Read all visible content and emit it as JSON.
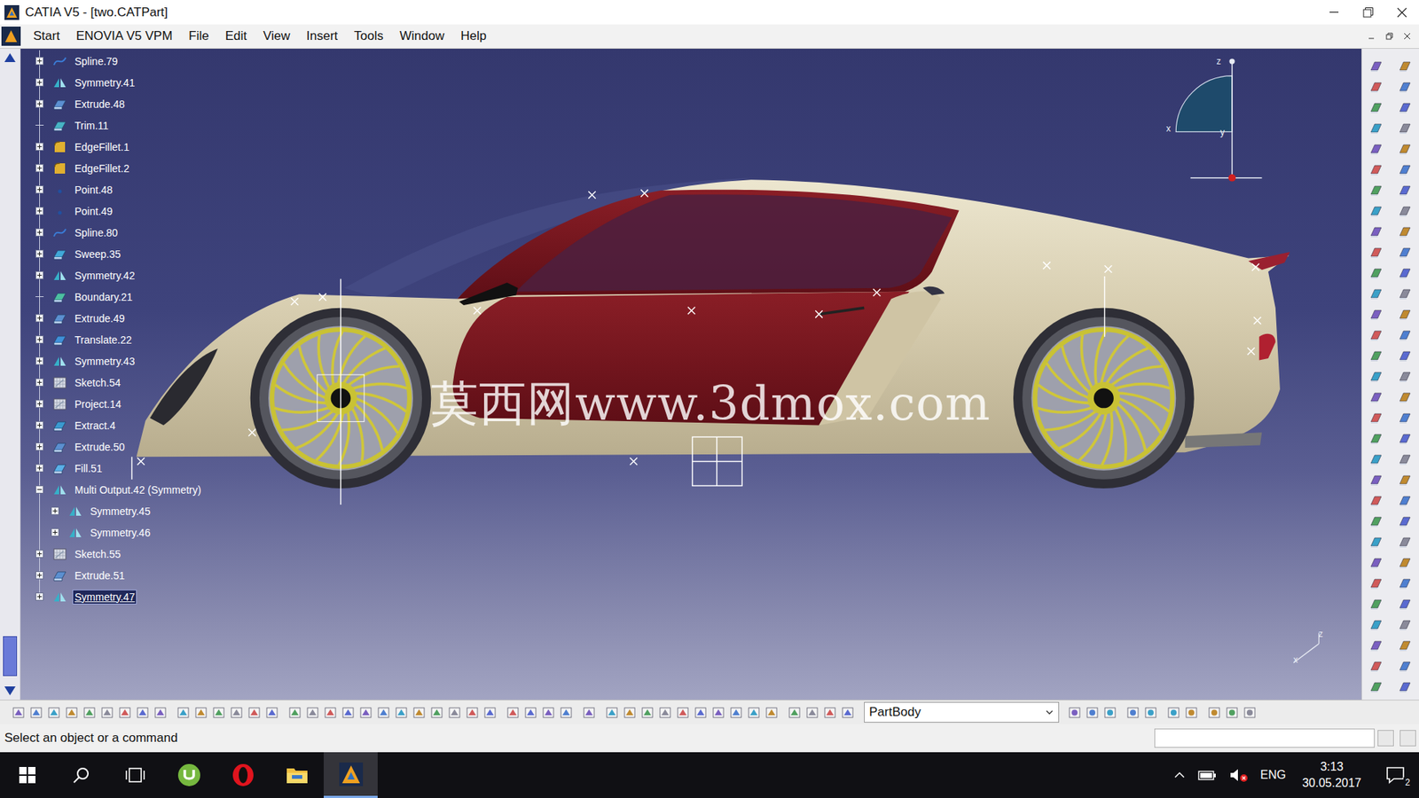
{
  "window": {
    "title": "CATIA V5 - [two.CATPart]"
  },
  "menu": [
    "Start",
    "ENOVIA V5 VPM",
    "File",
    "Edit",
    "View",
    "Insert",
    "Tools",
    "Window",
    "Help"
  ],
  "tree": [
    {
      "label": "Spline.79",
      "kind": "spline",
      "expandable": true,
      "expanded": false,
      "depth": 0,
      "selected": false
    },
    {
      "label": "Symmetry.41",
      "kind": "symmetry",
      "expandable": true,
      "expanded": false,
      "depth": 0,
      "selected": false
    },
    {
      "label": "Extrude.48",
      "kind": "extrude",
      "expandable": true,
      "expanded": false,
      "depth": 0,
      "selected": false
    },
    {
      "label": "Trim.11",
      "kind": "trim",
      "expandable": false,
      "expanded": false,
      "depth": 0,
      "selected": false
    },
    {
      "label": "EdgeFillet.1",
      "kind": "fillet",
      "expandable": true,
      "expanded": false,
      "depth": 0,
      "selected": false
    },
    {
      "label": "EdgeFillet.2",
      "kind": "fillet",
      "expandable": true,
      "expanded": false,
      "depth": 0,
      "selected": false
    },
    {
      "label": "Point.48",
      "kind": "point",
      "expandable": true,
      "expanded": false,
      "depth": 0,
      "selected": false
    },
    {
      "label": "Point.49",
      "kind": "point",
      "expandable": true,
      "expanded": false,
      "depth": 0,
      "selected": false
    },
    {
      "label": "Spline.80",
      "kind": "spline",
      "expandable": true,
      "expanded": false,
      "depth": 0,
      "selected": false
    },
    {
      "label": "Sweep.35",
      "kind": "sweep",
      "expandable": true,
      "expanded": false,
      "depth": 0,
      "selected": false
    },
    {
      "label": "Symmetry.42",
      "kind": "symmetry",
      "expandable": true,
      "expanded": false,
      "depth": 0,
      "selected": false
    },
    {
      "label": "Boundary.21",
      "kind": "boundary",
      "expandable": false,
      "expanded": false,
      "depth": 0,
      "selected": false
    },
    {
      "label": "Extrude.49",
      "kind": "extrude",
      "expandable": true,
      "expanded": false,
      "depth": 0,
      "selected": false
    },
    {
      "label": "Translate.22",
      "kind": "translate",
      "expandable": true,
      "expanded": false,
      "depth": 0,
      "selected": false
    },
    {
      "label": "Symmetry.43",
      "kind": "symmetry",
      "expandable": true,
      "expanded": false,
      "depth": 0,
      "selected": false
    },
    {
      "label": "Sketch.54",
      "kind": "sketch",
      "expandable": true,
      "expanded": false,
      "depth": 0,
      "selected": false
    },
    {
      "label": "Project.14",
      "kind": "sketch",
      "expandable": true,
      "expanded": false,
      "depth": 0,
      "selected": false
    },
    {
      "label": "Extract.4",
      "kind": "extract",
      "expandable": true,
      "expanded": false,
      "depth": 0,
      "selected": false
    },
    {
      "label": "Extrude.50",
      "kind": "extrude",
      "expandable": true,
      "expanded": false,
      "depth": 0,
      "selected": false
    },
    {
      "label": "Fill.51",
      "kind": "fill",
      "expandable": true,
      "expanded": false,
      "depth": 0,
      "selected": false
    },
    {
      "label": "Multi Output.42 (Symmetry)",
      "kind": "symmetry",
      "expandable": true,
      "expanded": true,
      "depth": 0,
      "selected": false
    },
    {
      "label": "Symmetry.45",
      "kind": "symmetry",
      "expandable": true,
      "expanded": false,
      "depth": 1,
      "selected": false
    },
    {
      "label": "Symmetry.46",
      "kind": "symmetry",
      "expandable": true,
      "expanded": false,
      "depth": 1,
      "selected": false
    },
    {
      "label": "Sketch.55",
      "kind": "sketch",
      "expandable": true,
      "expanded": false,
      "depth": 0,
      "selected": false
    },
    {
      "label": "Extrude.51",
      "kind": "extrude",
      "expandable": true,
      "expanded": false,
      "depth": 0,
      "selected": false
    },
    {
      "label": "Symmetry.47",
      "kind": "symmetry",
      "expandable": true,
      "expanded": false,
      "depth": 0,
      "selected": true
    }
  ],
  "watermark": "莫西网www.3dmox.com",
  "compass": {
    "z": "z",
    "x": "x",
    "y": "y"
  },
  "axis": {
    "z": "z",
    "x": "x"
  },
  "toolbar": {
    "body": "PartBody"
  },
  "status_bar": {
    "text": "Select an object or a command"
  },
  "taskbar": {
    "language": "ENG",
    "time": "3:13",
    "date": "30.05.2017",
    "notifications": "2"
  }
}
